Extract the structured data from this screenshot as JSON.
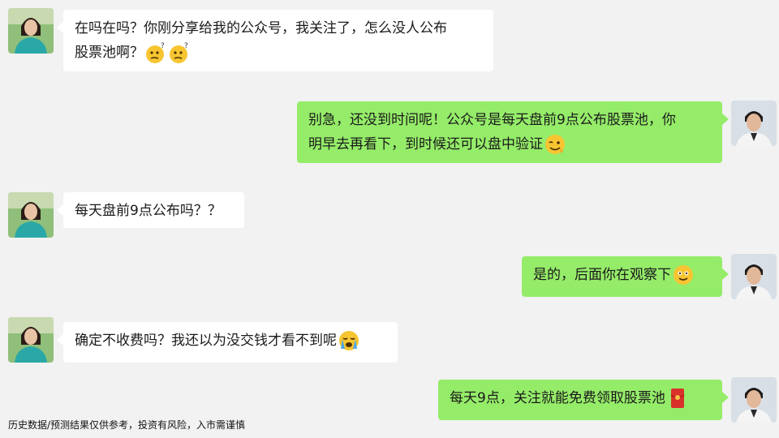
{
  "messages": [
    {
      "side": "left",
      "text_lines": [
        "在吗在吗？你刚分享给我的公众号，我关注了，怎么没人公布",
        "股票池啊？"
      ],
      "emojis": [
        "thinking-face-icon",
        "thinking-face-icon"
      ]
    },
    {
      "side": "right",
      "text_lines": [
        "别急，还没到时间呢！公众号是每天盘前9点公布股票池，你",
        "明早去再看下，到时候还可以盘中验证"
      ],
      "emojis": [
        "wink-face-icon"
      ]
    },
    {
      "side": "left",
      "text_lines": [
        "每天盘前9点公布吗？？"
      ],
      "emojis": []
    },
    {
      "side": "right",
      "text_lines": [
        "是的，后面你在观察下"
      ],
      "emojis": [
        "smile-face-icon"
      ]
    },
    {
      "side": "left",
      "text_lines": [
        "确定不收费吗？我还以为没交钱才看不到呢"
      ],
      "emojis": [
        "crying-face-icon"
      ]
    },
    {
      "side": "right",
      "text_lines": [
        "每天9点，关注就能免费领取股票池"
      ],
      "emojis": [
        "red-packet-icon"
      ]
    }
  ],
  "footer": {
    "disclaimer": "历史数据/预测结果仅供参考，投资有风险，入市需谨慎"
  },
  "colors": {
    "background": "#f2f2f2",
    "left_bubble": "#ffffff",
    "right_bubble": "#95ec69"
  }
}
